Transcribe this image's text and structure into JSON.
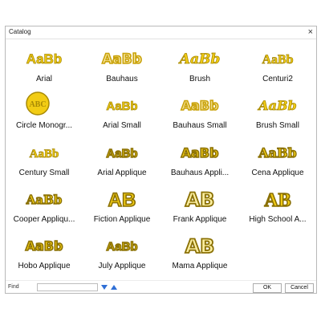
{
  "window": {
    "title": "Catalog",
    "close_glyph": "×"
  },
  "fonts": [
    {
      "name": "Arial"
    },
    {
      "name": "Bauhaus"
    },
    {
      "name": "Brush"
    },
    {
      "name": "Centuri2"
    },
    {
      "name": "Circle Monogr..."
    },
    {
      "name": "Arial Small"
    },
    {
      "name": "Bauhaus Small"
    },
    {
      "name": "Brush Small"
    },
    {
      "name": "Century Small"
    },
    {
      "name": "Arial Applique"
    },
    {
      "name": "Bauhaus Appli..."
    },
    {
      "name": "Cena Applique"
    },
    {
      "name": "Cooper Appliqu..."
    },
    {
      "name": "Fiction Applique"
    },
    {
      "name": "Frank Applique"
    },
    {
      "name": "High School A..."
    },
    {
      "name": "Hobo Applique"
    },
    {
      "name": "July Applique"
    },
    {
      "name": "Mama Applique"
    }
  ],
  "preview": {
    "sample_text": "AaBb",
    "monogram_text": "ABC",
    "applique_text": "AB",
    "fill_color": "#f2cc14",
    "stroke_color": "#a88a05"
  },
  "footer": {
    "find_label": "Find",
    "find_value": "",
    "down_icon": "arrow-down-icon",
    "up_icon": "arrow-up-icon",
    "ok_label": "OK",
    "cancel_label": "Cancel",
    "accent": "#2f6fd6"
  }
}
